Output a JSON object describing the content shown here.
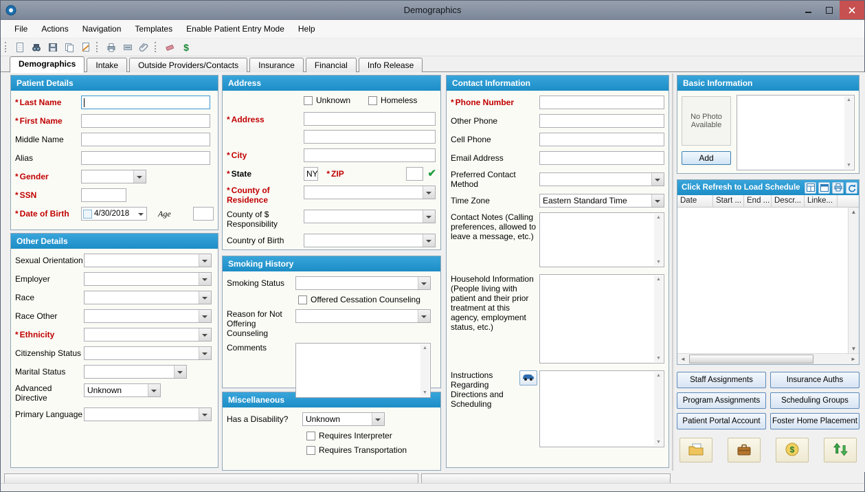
{
  "window": {
    "title": "Demographics"
  },
  "menu": [
    "File",
    "Actions",
    "Navigation",
    "Templates",
    "Enable Patient Entry Mode",
    "Help"
  ],
  "toolbar": {
    "icons": [
      "new-document",
      "search",
      "save",
      "copy",
      "signature",
      "print",
      "scan",
      "attachment",
      "eraser",
      "billing"
    ]
  },
  "tabs": [
    "Demographics",
    "Intake",
    "Outside Providers/Contacts",
    "Insurance",
    "Financial",
    "Info Release"
  ],
  "icons": {
    "asterisk": "*",
    "up": "▲",
    "down": "▼",
    "left": "◄",
    "right": "►",
    "check": "✔",
    "dollar": "$"
  },
  "panels": {
    "patient_details": {
      "title": "Patient Details",
      "last_name": "Last Name",
      "first_name": "First Name",
      "middle_name": "Middle Name",
      "alias": "Alias",
      "gender": "Gender",
      "ssn": "SSN",
      "dob": "Date of Birth",
      "dob_value": "4/30/2018",
      "age": "Age"
    },
    "other_details": {
      "title": "Other Details",
      "sexual_orientation": "Sexual Orientation",
      "employer": "Employer",
      "race": "Race",
      "race_other": "Race Other",
      "ethnicity": "Ethnicity",
      "citizenship": "Citizenship Status",
      "marital": "Marital Status",
      "advanced": "Advanced Directive",
      "advanced_value": "Unknown",
      "language": "Primary Language"
    },
    "address": {
      "title": "Address",
      "unknown": "Unknown",
      "homeless": "Homeless",
      "address": "Address",
      "city": "City",
      "state": "State",
      "state_value": "NY",
      "zip": "ZIP",
      "county_res": "County of Residence",
      "county_resp": "County of $ Responsibility",
      "country_birth": "Country of Birth"
    },
    "smoking": {
      "title": "Smoking History",
      "status": "Smoking Status",
      "offered": "Offered Cessation Counseling",
      "reason": "Reason for Not Offering Counseling",
      "comments": "Comments"
    },
    "misc": {
      "title": "Miscellaneous",
      "disability": "Has a Disability?",
      "disability_value": "Unknown",
      "interpreter": "Requires Interpreter",
      "transportation": "Requires Transportation"
    },
    "contact": {
      "title": "Contact Information",
      "phone": "Phone Number",
      "other_phone": "Other Phone",
      "cell": "Cell Phone",
      "email": "Email Address",
      "preferred": "Preferred Contact Method",
      "timezone": "Time Zone",
      "timezone_value": "Eastern Standard Time",
      "notes": "Contact Notes (Calling preferences, allowed to leave a message, etc.)",
      "household": "Household Information (People living with patient and their prior treatment at this agency, employment status, etc.)",
      "instructions": "Instructions Regarding Directions and Scheduling"
    },
    "basic": {
      "title": "Basic Information",
      "no_photo": "No Photo Available",
      "add": "Add"
    },
    "schedule": {
      "title": "Click Refresh to Load Schedule",
      "columns": [
        "Date",
        "Start ...",
        "End ...",
        "Descr...",
        "Linke..."
      ]
    },
    "actions": {
      "buttons": [
        "Staff Assignments",
        "Insurance Auths",
        "Program Assignments",
        "Scheduling Groups",
        "Patient Portal Account",
        "Foster Home Placement"
      ]
    }
  }
}
